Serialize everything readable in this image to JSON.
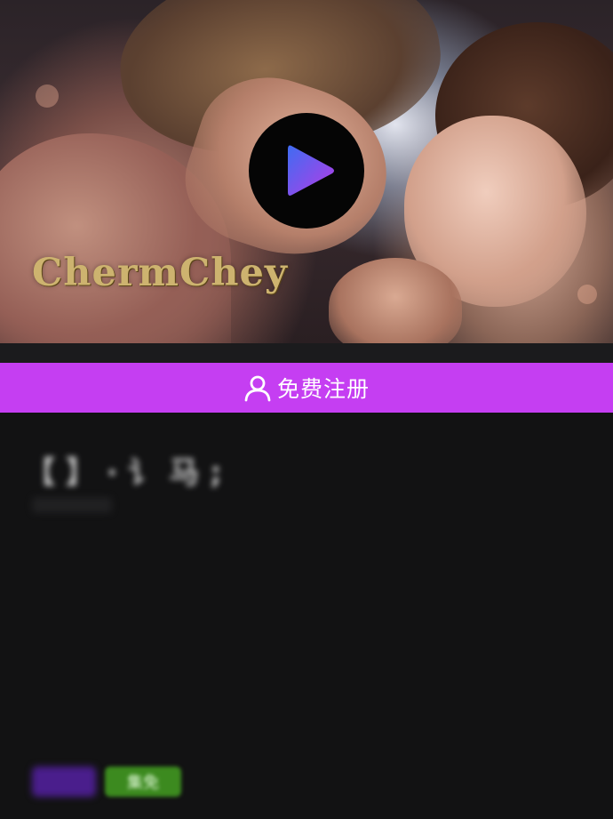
{
  "hero": {
    "watermark": "ChermChey",
    "play_icon": "play-icon",
    "play_gradient": [
      "#3f6cf2",
      "#b63ce6"
    ]
  },
  "register": {
    "icon": "user-icon",
    "label": "免费注册",
    "color": "#c53ef2"
  },
  "content": {
    "title": "【     】 · 讠 马 ;",
    "tags": [
      {
        "label": "",
        "color": "#4a1e8c"
      },
      {
        "label": "集免",
        "color": "#3c8a1f"
      }
    ]
  }
}
